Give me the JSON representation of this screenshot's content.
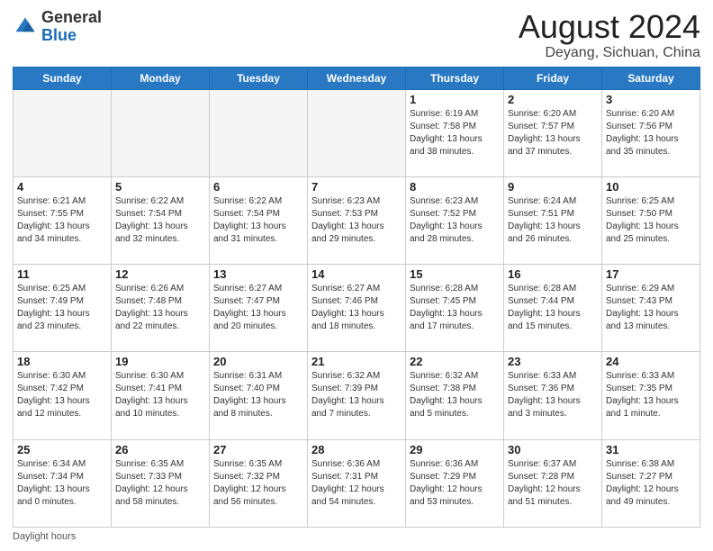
{
  "logo": {
    "line1": "General",
    "line2": "Blue"
  },
  "title": "August 2024",
  "subtitle": "Deyang, Sichuan, China",
  "days_of_week": [
    "Sunday",
    "Monday",
    "Tuesday",
    "Wednesday",
    "Thursday",
    "Friday",
    "Saturday"
  ],
  "footer_label": "Daylight hours",
  "weeks": [
    [
      {
        "day": "",
        "info": ""
      },
      {
        "day": "",
        "info": ""
      },
      {
        "day": "",
        "info": ""
      },
      {
        "day": "",
        "info": ""
      },
      {
        "day": "1",
        "info": "Sunrise: 6:19 AM\nSunset: 7:58 PM\nDaylight: 13 hours\nand 38 minutes."
      },
      {
        "day": "2",
        "info": "Sunrise: 6:20 AM\nSunset: 7:57 PM\nDaylight: 13 hours\nand 37 minutes."
      },
      {
        "day": "3",
        "info": "Sunrise: 6:20 AM\nSunset: 7:56 PM\nDaylight: 13 hours\nand 35 minutes."
      }
    ],
    [
      {
        "day": "4",
        "info": "Sunrise: 6:21 AM\nSunset: 7:55 PM\nDaylight: 13 hours\nand 34 minutes."
      },
      {
        "day": "5",
        "info": "Sunrise: 6:22 AM\nSunset: 7:54 PM\nDaylight: 13 hours\nand 32 minutes."
      },
      {
        "day": "6",
        "info": "Sunrise: 6:22 AM\nSunset: 7:54 PM\nDaylight: 13 hours\nand 31 minutes."
      },
      {
        "day": "7",
        "info": "Sunrise: 6:23 AM\nSunset: 7:53 PM\nDaylight: 13 hours\nand 29 minutes."
      },
      {
        "day": "8",
        "info": "Sunrise: 6:23 AM\nSunset: 7:52 PM\nDaylight: 13 hours\nand 28 minutes."
      },
      {
        "day": "9",
        "info": "Sunrise: 6:24 AM\nSunset: 7:51 PM\nDaylight: 13 hours\nand 26 minutes."
      },
      {
        "day": "10",
        "info": "Sunrise: 6:25 AM\nSunset: 7:50 PM\nDaylight: 13 hours\nand 25 minutes."
      }
    ],
    [
      {
        "day": "11",
        "info": "Sunrise: 6:25 AM\nSunset: 7:49 PM\nDaylight: 13 hours\nand 23 minutes."
      },
      {
        "day": "12",
        "info": "Sunrise: 6:26 AM\nSunset: 7:48 PM\nDaylight: 13 hours\nand 22 minutes."
      },
      {
        "day": "13",
        "info": "Sunrise: 6:27 AM\nSunset: 7:47 PM\nDaylight: 13 hours\nand 20 minutes."
      },
      {
        "day": "14",
        "info": "Sunrise: 6:27 AM\nSunset: 7:46 PM\nDaylight: 13 hours\nand 18 minutes."
      },
      {
        "day": "15",
        "info": "Sunrise: 6:28 AM\nSunset: 7:45 PM\nDaylight: 13 hours\nand 17 minutes."
      },
      {
        "day": "16",
        "info": "Sunrise: 6:28 AM\nSunset: 7:44 PM\nDaylight: 13 hours\nand 15 minutes."
      },
      {
        "day": "17",
        "info": "Sunrise: 6:29 AM\nSunset: 7:43 PM\nDaylight: 13 hours\nand 13 minutes."
      }
    ],
    [
      {
        "day": "18",
        "info": "Sunrise: 6:30 AM\nSunset: 7:42 PM\nDaylight: 13 hours\nand 12 minutes."
      },
      {
        "day": "19",
        "info": "Sunrise: 6:30 AM\nSunset: 7:41 PM\nDaylight: 13 hours\nand 10 minutes."
      },
      {
        "day": "20",
        "info": "Sunrise: 6:31 AM\nSunset: 7:40 PM\nDaylight: 13 hours\nand 8 minutes."
      },
      {
        "day": "21",
        "info": "Sunrise: 6:32 AM\nSunset: 7:39 PM\nDaylight: 13 hours\nand 7 minutes."
      },
      {
        "day": "22",
        "info": "Sunrise: 6:32 AM\nSunset: 7:38 PM\nDaylight: 13 hours\nand 5 minutes."
      },
      {
        "day": "23",
        "info": "Sunrise: 6:33 AM\nSunset: 7:36 PM\nDaylight: 13 hours\nand 3 minutes."
      },
      {
        "day": "24",
        "info": "Sunrise: 6:33 AM\nSunset: 7:35 PM\nDaylight: 13 hours\nand 1 minute."
      }
    ],
    [
      {
        "day": "25",
        "info": "Sunrise: 6:34 AM\nSunset: 7:34 PM\nDaylight: 13 hours\nand 0 minutes."
      },
      {
        "day": "26",
        "info": "Sunrise: 6:35 AM\nSunset: 7:33 PM\nDaylight: 12 hours\nand 58 minutes."
      },
      {
        "day": "27",
        "info": "Sunrise: 6:35 AM\nSunset: 7:32 PM\nDaylight: 12 hours\nand 56 minutes."
      },
      {
        "day": "28",
        "info": "Sunrise: 6:36 AM\nSunset: 7:31 PM\nDaylight: 12 hours\nand 54 minutes."
      },
      {
        "day": "29",
        "info": "Sunrise: 6:36 AM\nSunset: 7:29 PM\nDaylight: 12 hours\nand 53 minutes."
      },
      {
        "day": "30",
        "info": "Sunrise: 6:37 AM\nSunset: 7:28 PM\nDaylight: 12 hours\nand 51 minutes."
      },
      {
        "day": "31",
        "info": "Sunrise: 6:38 AM\nSunset: 7:27 PM\nDaylight: 12 hours\nand 49 minutes."
      }
    ]
  ]
}
